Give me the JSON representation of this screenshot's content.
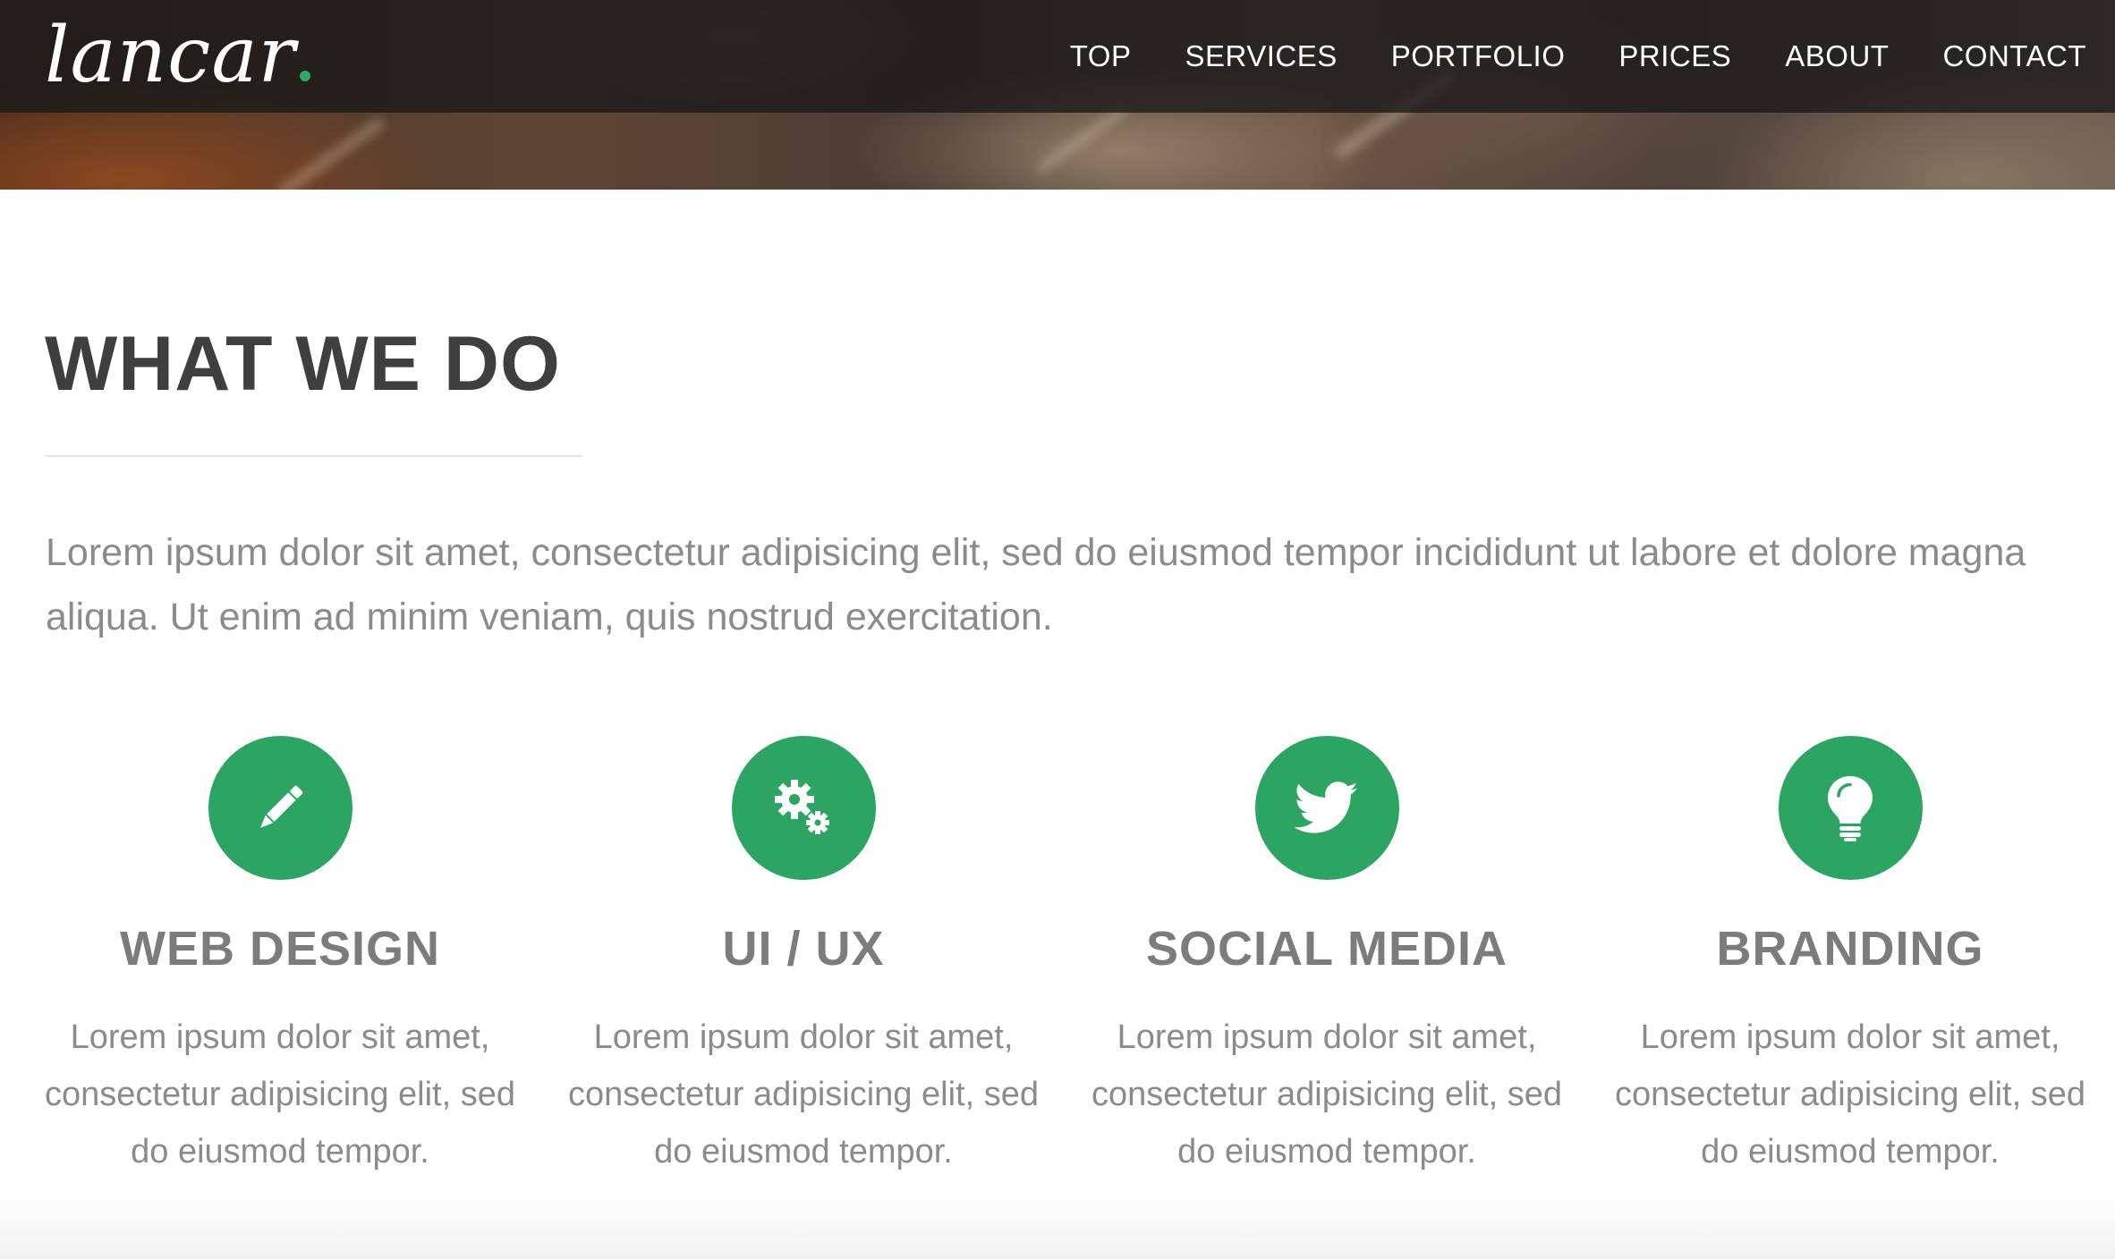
{
  "header": {
    "logo_text": "lancar",
    "nav": [
      {
        "label": "TOP"
      },
      {
        "label": "SERVICES"
      },
      {
        "label": "PORTFOLIO"
      },
      {
        "label": "PRICES"
      },
      {
        "label": "ABOUT"
      },
      {
        "label": "CONTACT"
      }
    ]
  },
  "section": {
    "title": "WHAT WE DO",
    "intro": "Lorem ipsum dolor sit amet, consectetur adipisicing elit, sed do eiusmod tempor incididunt ut labore et dolore magna aliqua. Ut enim ad minim veniam, quis nostrud exercitation."
  },
  "services": [
    {
      "icon": "pencil-icon",
      "title": "WEB DESIGN",
      "text": "Lorem ipsum dolor sit amet, consectetur adipisicing elit, sed do eiusmod tempor."
    },
    {
      "icon": "gears-icon",
      "title": "UI / UX",
      "text": "Lorem ipsum dolor sit amet, consectetur adipisicing elit, sed do eiusmod tempor."
    },
    {
      "icon": "twitter-bird-icon",
      "title": "SOCIAL MEDIA",
      "text": "Lorem ipsum dolor sit amet, consectetur adipisicing elit, sed do eiusmod tempor."
    },
    {
      "icon": "lightbulb-icon",
      "title": "BRANDING",
      "text": "Lorem ipsum dolor sit amet, consectetur adipisicing elit, sed do eiusmod tempor."
    }
  ],
  "colors": {
    "accent": "#2ca462",
    "heading": "#3f3f3f",
    "service_heading": "#7c7c7c",
    "body_text": "#8b8b8b",
    "navbar": "#181818"
  }
}
